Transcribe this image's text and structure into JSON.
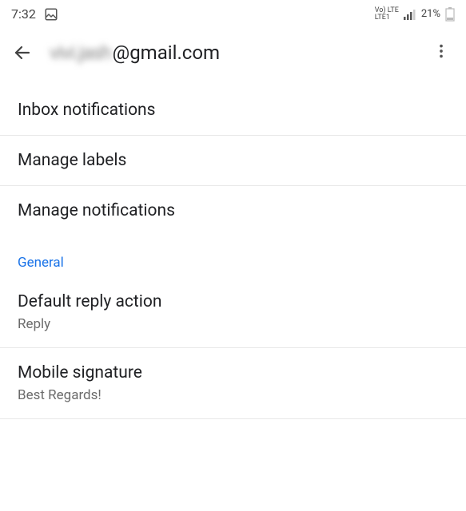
{
  "statusBar": {
    "time": "7:32",
    "networkLine1": "Vo)  LTE",
    "networkLine2": "LTE1",
    "battery": "21%"
  },
  "header": {
    "emailPrefixBlurred": "vivi.jash",
    "emailSuffix": "@gmail.com"
  },
  "items": {
    "inboxNotifications": "Inbox notifications",
    "manageLabels": "Manage labels",
    "manageNotifications": "Manage notifications"
  },
  "section": {
    "general": "General"
  },
  "defaultReply": {
    "title": "Default reply action",
    "value": "Reply"
  },
  "mobileSignature": {
    "title": "Mobile signature",
    "value": "Best Regards!"
  }
}
